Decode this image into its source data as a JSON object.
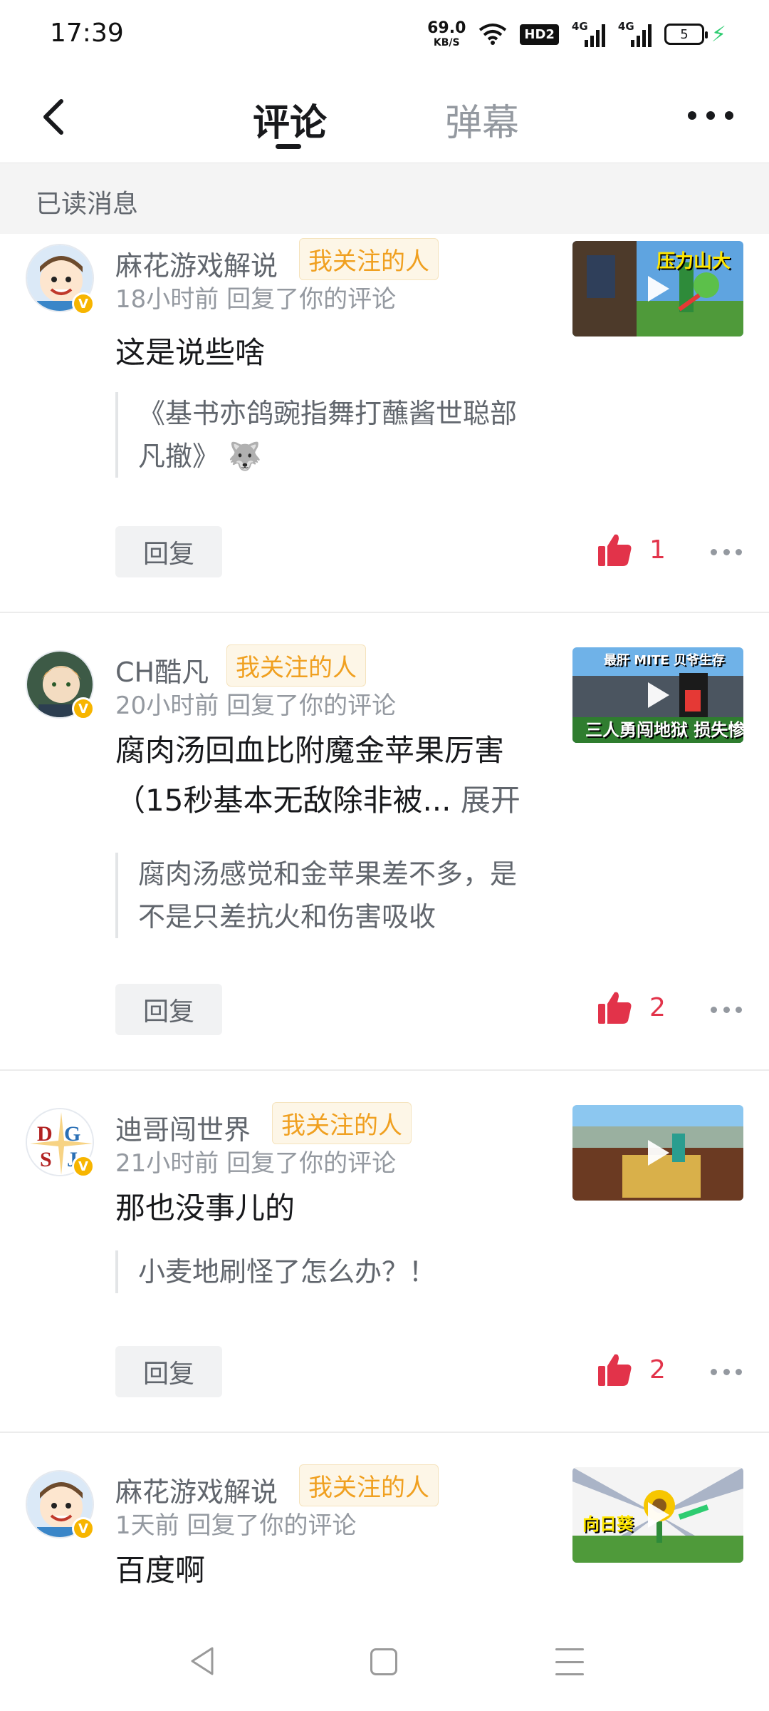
{
  "status_bar": {
    "time": "17:39",
    "net_speed_value": "69.0",
    "net_speed_unit": "KB/S",
    "hd_badge": "HD2",
    "signal_1_type": "4G",
    "signal_2_type": "4G",
    "battery_level": "5"
  },
  "header": {
    "tabs": [
      {
        "label": "评论",
        "active": true
      },
      {
        "label": "弹幕",
        "active": false
      }
    ]
  },
  "section": {
    "label": "已读消息"
  },
  "comments": [
    {
      "username": "麻花游戏解说",
      "follow_tag": "我关注的人",
      "time": "18小时前",
      "action": "回复了你的评论",
      "content": "这是说些啥",
      "expand_label": "",
      "quote": "《基书亦鸽豌指舞打蘸酱世聪部凡撤》",
      "quote_emoji": "🐺",
      "reply_label": "回复",
      "like_count": "1",
      "thumb_text": "压力山大"
    },
    {
      "username": "CH酷凡",
      "follow_tag": "我关注的人",
      "time": "20小时前",
      "action": "回复了你的评论",
      "content": "腐肉汤回血比附魔金苹果厉害（15秒基本无敌除非被...",
      "expand_label": "展开",
      "quote": "腐肉汤感觉和金苹果差不多，是不是只差抗火和伤害吸收",
      "quote_emoji": "",
      "reply_label": "回复",
      "like_count": "2",
      "thumb_text": "最肝 MITE 贝爷生存",
      "thumb_text_2": "三人勇闯地狱 损失惨重"
    },
    {
      "username": "迪哥闯世界",
      "follow_tag": "我关注的人",
      "time": "21小时前",
      "action": "回复了你的评论",
      "content": "那也没事儿的",
      "expand_label": "",
      "quote": "小麦地刷怪了怎么办？！",
      "quote_emoji": "",
      "reply_label": "回复",
      "like_count": "2",
      "thumb_text": ""
    },
    {
      "username": "麻花游戏解说",
      "follow_tag": "我关注的人",
      "time": "1天前",
      "action": "回复了你的评论",
      "content": "百度啊",
      "expand_label": "",
      "quote": "",
      "quote_emoji": "",
      "reply_label": "",
      "like_count": "",
      "thumb_text": "向日葵"
    }
  ],
  "avatar_3_letters": {
    "d": "D",
    "g": "G",
    "s": "S",
    "j": "J"
  },
  "colors": {
    "accent_like": "#e2334a",
    "follow_tag": "#f0a020",
    "verified_badge": "#f7b500",
    "charging": "#2ecc71"
  },
  "icons": [
    "back-icon",
    "more-icon",
    "like-icon",
    "play-icon",
    "verified-icon",
    "nav-back-icon",
    "nav-home-icon",
    "nav-menu-icon"
  ]
}
